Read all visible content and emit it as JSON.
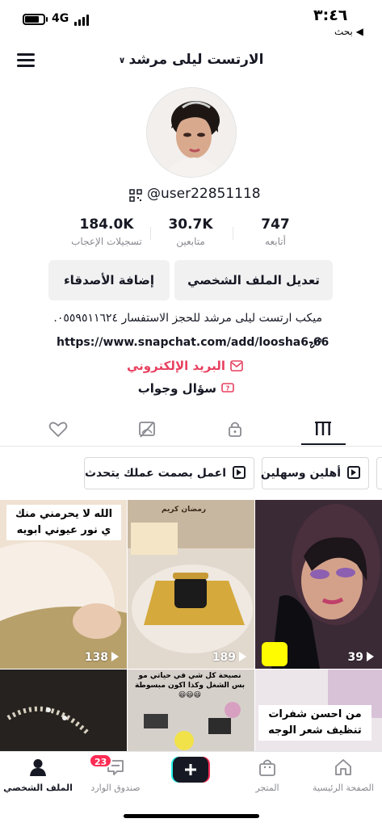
{
  "status_bar": {
    "time": "٣:٤٦",
    "back_label": "◀ بحث",
    "network": "4G",
    "battery_level": 0.75
  },
  "header": {
    "title": "الارتست ليلى مرشد",
    "chevron": "∨"
  },
  "profile": {
    "username": "@user22851118",
    "stats": [
      {
        "value": "747",
        "label": "أتابعه"
      },
      {
        "value": "30.7K",
        "label": "متابعين"
      },
      {
        "value": "184.0K",
        "label": "تسجيلات الإعجاب"
      }
    ],
    "edit_button": "تعديل الملف الشخصي",
    "add_friends_button": "إضافة الأصدقاء",
    "bio": "ميكب ارتست ليلى مرشد للحجز الاستفسار ٠٥٥٩٥١١٦٢٤.",
    "link": "https://www.snapchat.com/add/loosha6-66",
    "email": "البريد الإلكتروني",
    "qa": "سؤال وجواب"
  },
  "playlists": [
    "أهلين وسهلين",
    "اعمل بصمت  عملك يتحدث"
  ],
  "videos": [
    {
      "views": "39",
      "caption": ""
    },
    {
      "views": "189",
      "caption": "رمضان كريم"
    },
    {
      "views": "138",
      "caption": "الله لا يحرمني منك ي نور عيوني ابويه"
    },
    {
      "views": "",
      "caption": "من احسن شفرات تنظيف شعر الوجه"
    },
    {
      "views": "",
      "caption": "نصيحة كل شي في حياتي مو بس الشغل وكذا اكون مبسوطة😃😃😃"
    },
    {
      "views": "",
      "caption": ""
    }
  ],
  "bottom_nav": {
    "home": "الصفحة الرئيسية",
    "shop": "المتجر",
    "inbox": "صندوق الوارد",
    "inbox_badge": "23",
    "profile": "الملف الشخصي"
  },
  "colors": {
    "accent": "#fe2c55",
    "email": "#e8405f",
    "text": "#161823",
    "muted": "#8a8b91"
  }
}
